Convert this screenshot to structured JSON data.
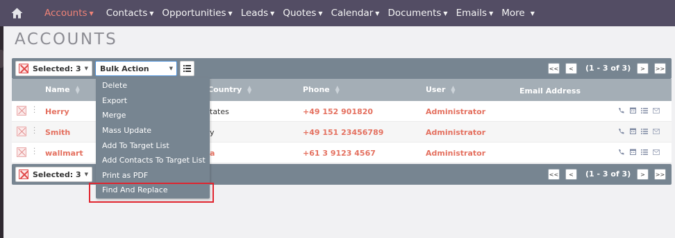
{
  "nav": {
    "items": [
      {
        "label": "Accounts",
        "active": true
      },
      {
        "label": "Contacts"
      },
      {
        "label": "Opportunities"
      },
      {
        "label": "Leads"
      },
      {
        "label": "Quotes"
      },
      {
        "label": "Calendar"
      },
      {
        "label": "Documents"
      },
      {
        "label": "Emails"
      },
      {
        "label": "More"
      }
    ]
  },
  "page_title": "ACCOUNTS",
  "list_bar": {
    "selected": "Selected: 3",
    "bulk_action": "Bulk Action",
    "pagination": "(1 - 3 of 3)",
    "first": "<<",
    "prev": "<",
    "next": ">",
    "last": ">>"
  },
  "table": {
    "headers": [
      "Name",
      "Country",
      "Phone",
      "User",
      "Email Address"
    ],
    "rows": [
      {
        "name": "Herry",
        "country": "tates",
        "phone": "+49 152 901820",
        "user": "Administrator"
      },
      {
        "name": "Smith",
        "country": "y",
        "phone": "+49 151 23456789",
        "user": "Administrator"
      },
      {
        "name": "wallmart",
        "country": "a",
        "phone": "+61 3 9123 4567",
        "user": "Administrator"
      }
    ]
  },
  "bulk_menu": {
    "items": [
      "Delete",
      "Export",
      "Merge",
      "Mass Update",
      "Add To Target List",
      "Add Contacts To Target List",
      "Print as PDF",
      "Find And Replace"
    ]
  },
  "colors": {
    "nav_bg": "#534d64",
    "accent": "#f08377",
    "bar_bg": "#778591",
    "link": "#e4705f",
    "highlight": "#e0242e"
  }
}
